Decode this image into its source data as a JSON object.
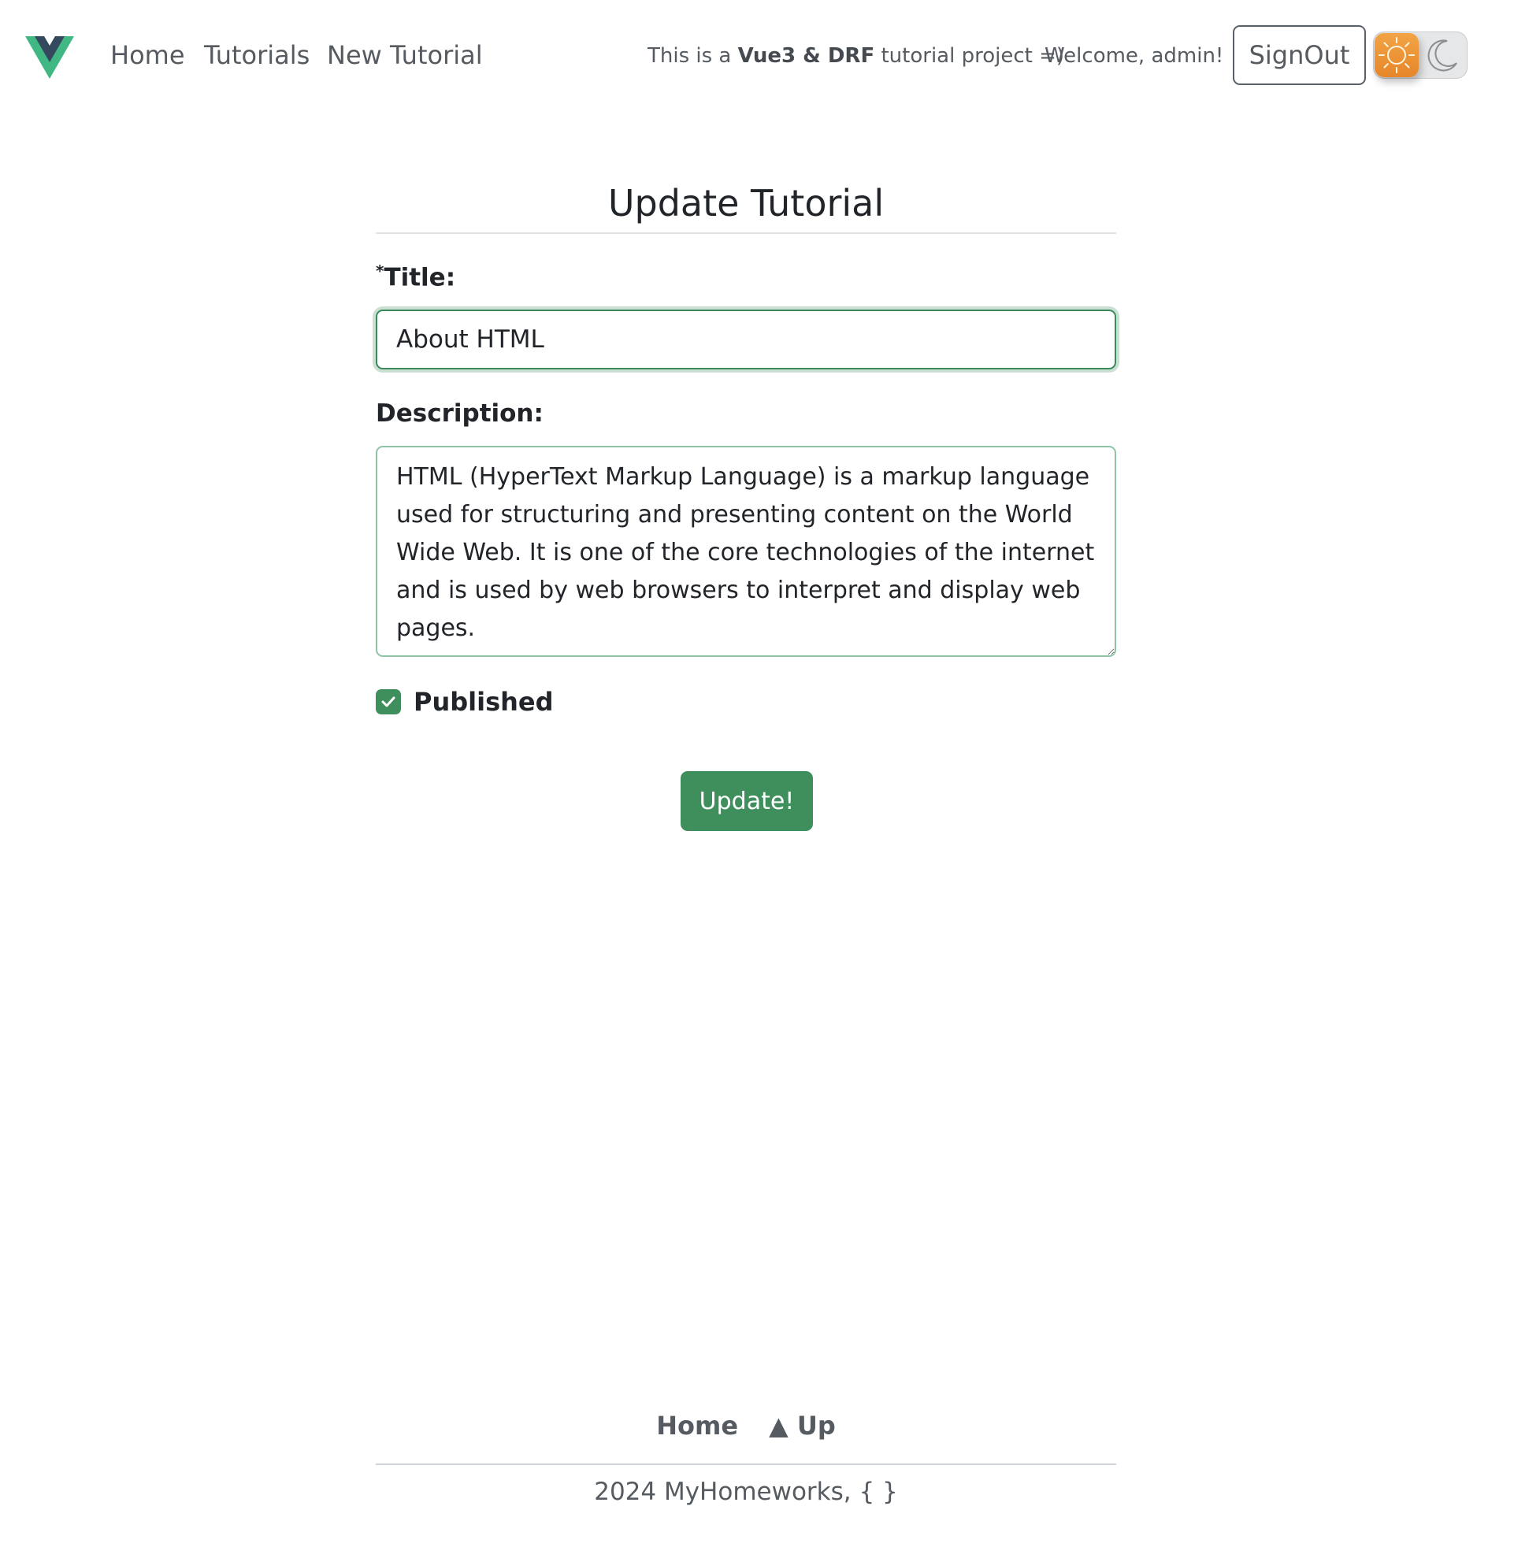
{
  "navbar": {
    "links": {
      "home": "Home",
      "tutorials": "Tutorials",
      "new_tutorial": "New Tutorial"
    },
    "tagline": {
      "prefix": "This is a ",
      "bold": "Vue3 & DRF",
      "suffix": " tutorial project =)"
    },
    "welcome": "Welcome, admin!",
    "signout_label": "SignOut",
    "theme_toggle": {
      "state": "light",
      "light_icon": "sun-icon",
      "dark_icon": "moon-icon"
    },
    "logo_icon": "vue-logo-icon"
  },
  "form": {
    "heading": "Update Tutorial",
    "title_required_mark": "*",
    "title_label": "Title:",
    "title_value": "About HTML",
    "description_label": "Description:",
    "description_value": "HTML (HyperText Markup Language) is a markup language used for structuring and presenting content on the World Wide Web. It is one of the core technologies of the internet and is used by web browsers to interpret and display web pages.",
    "published_label": "Published",
    "published_checked": true,
    "submit_label": "Update!"
  },
  "footer": {
    "home_label": "Home",
    "up_label": "▲ Up",
    "copyright": "2024 MyHomeworks, { }"
  },
  "colors": {
    "accent": "#3f8f5d",
    "logo_green": "#41b883",
    "logo_dark": "#34495e",
    "text_muted": "#555b61"
  }
}
